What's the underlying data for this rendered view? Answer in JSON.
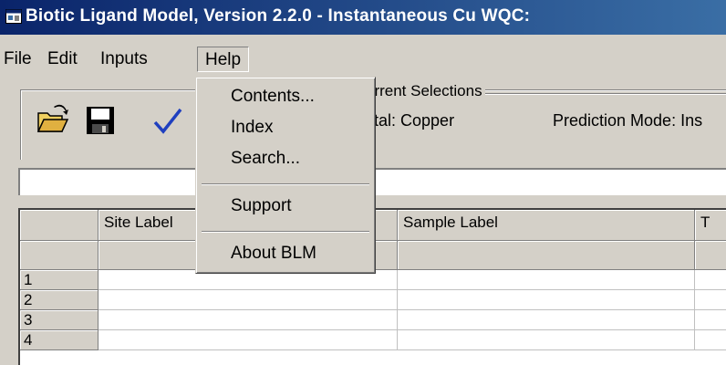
{
  "window": {
    "title": "Biotic Ligand Model, Version 2.2.0 - Instantaneous Cu WQC:"
  },
  "menubar": {
    "items": [
      "File",
      "Edit",
      "Inputs",
      "Help"
    ]
  },
  "toolbar": {
    "open_icon": "open-folder-icon",
    "save_icon": "floppy-save-icon",
    "check_icon": "checkmark-icon"
  },
  "selections": {
    "legend": "urrent Selections",
    "metal": "etal: Copper",
    "prediction": "Prediction Mode: Ins"
  },
  "grid": {
    "columns": [
      "",
      "Site Label",
      "",
      "Sample Label",
      "T"
    ],
    "rows": [
      "1",
      "2",
      "3",
      "4"
    ]
  },
  "help_menu": {
    "items": [
      "Contents...",
      "Index",
      "Search...",
      "Support",
      "About BLM"
    ]
  },
  "colors": {
    "titlebar_start": "#0a246a",
    "titlebar_end": "#3a6ea5",
    "face": "#d4d0c8",
    "check": "#1f3fbf"
  }
}
